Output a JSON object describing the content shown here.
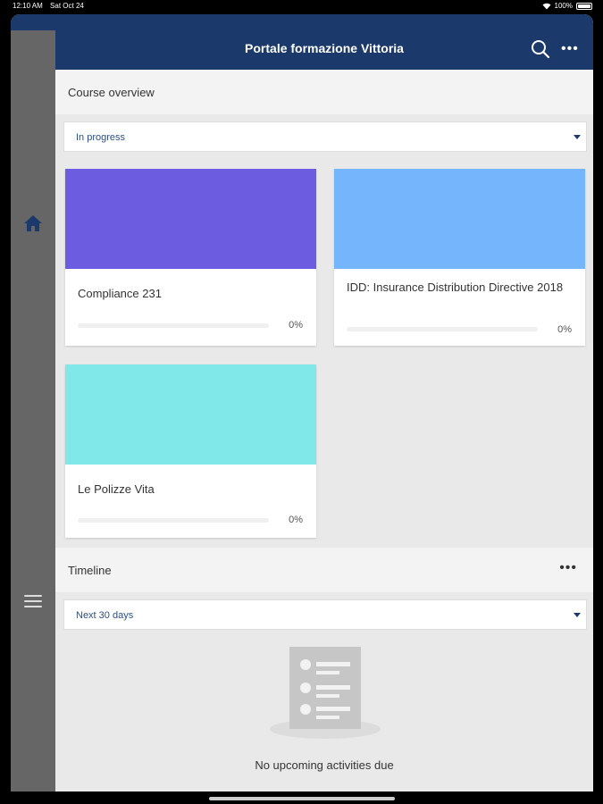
{
  "status_bar": {
    "time": "12:10 AM",
    "date": "Sat Oct 24",
    "battery": "100%"
  },
  "header": {
    "title": "Portale formazione Vittoria"
  },
  "course_overview": {
    "title": "Course overview",
    "filter": "In progress",
    "courses": [
      {
        "name": "Compliance 231",
        "progress_label": "0%",
        "progress": 0,
        "color": "#6c5ce0"
      },
      {
        "name": "IDD: Insurance Distribution Directive 2018",
        "progress_label": "0%",
        "progress": 0,
        "color": "#74b5fc"
      },
      {
        "name": "Le Polizze Vita",
        "progress_label": "0%",
        "progress": 0,
        "color": "#81e8ea"
      }
    ]
  },
  "timeline": {
    "title": "Timeline",
    "filter": "Next 30 days",
    "empty_message": "No upcoming activities due"
  },
  "colors": {
    "brand": "#1b3a6b",
    "sidebar": "#666666",
    "background": "#e9e9e9"
  }
}
